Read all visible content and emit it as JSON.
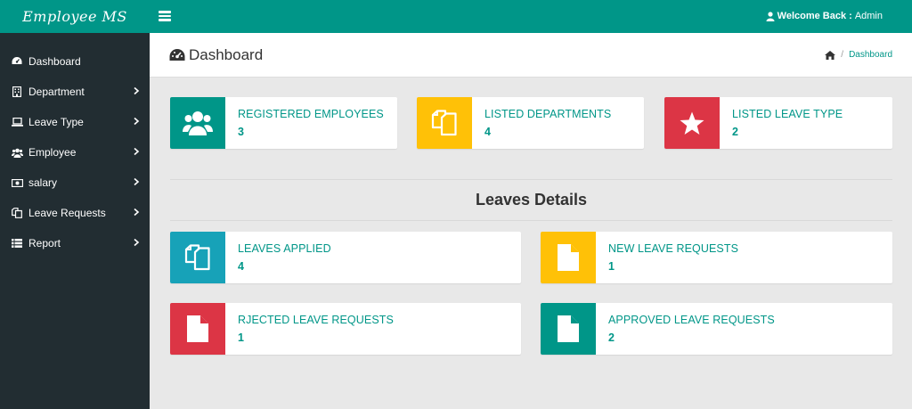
{
  "app": {
    "brand": "Employee MS"
  },
  "header": {
    "welcome_label": "Welcome Back :",
    "user_name": "Admin"
  },
  "sidebar": {
    "items": [
      {
        "label": "Dashboard",
        "icon": "dashboard-icon"
      },
      {
        "label": "Department",
        "icon": "building-icon"
      },
      {
        "label": "Leave Type",
        "icon": "laptop-icon"
      },
      {
        "label": "Employee",
        "icon": "users-icon"
      },
      {
        "label": "salary",
        "icon": "money-icon"
      },
      {
        "label": "Leave Requests",
        "icon": "copy-icon"
      },
      {
        "label": "Report",
        "icon": "list-icon"
      }
    ]
  },
  "page": {
    "title": "Dashboard",
    "breadcrumb": [
      "Dashboard"
    ]
  },
  "stats": [
    {
      "label": "REGISTERED EMPLOYEES",
      "value": "3",
      "color": "#009688",
      "icon": "users-icon"
    },
    {
      "label": "LISTED DEPARTMENTS",
      "value": "4",
      "color": "#ffc107",
      "icon": "copy-icon"
    },
    {
      "label": "LISTED LEAVE TYPE",
      "value": "2",
      "color": "#dc3545",
      "icon": "star-icon"
    }
  ],
  "leaves": {
    "title": "Leaves Details",
    "cards": [
      {
        "label": "LEAVES APPLIED",
        "value": "4",
        "color": "#17a2b8",
        "icon": "copy-icon"
      },
      {
        "label": "NEW LEAVE REQUESTS",
        "value": "1",
        "color": "#ffc107",
        "icon": "file-icon"
      },
      {
        "label": "RJECTED LEAVE REQUESTS",
        "value": "1",
        "color": "#dc3545",
        "icon": "file-icon"
      },
      {
        "label": "APPROVED LEAVE REQUESTS",
        "value": "2",
        "color": "#009688",
        "icon": "file-icon"
      }
    ]
  }
}
